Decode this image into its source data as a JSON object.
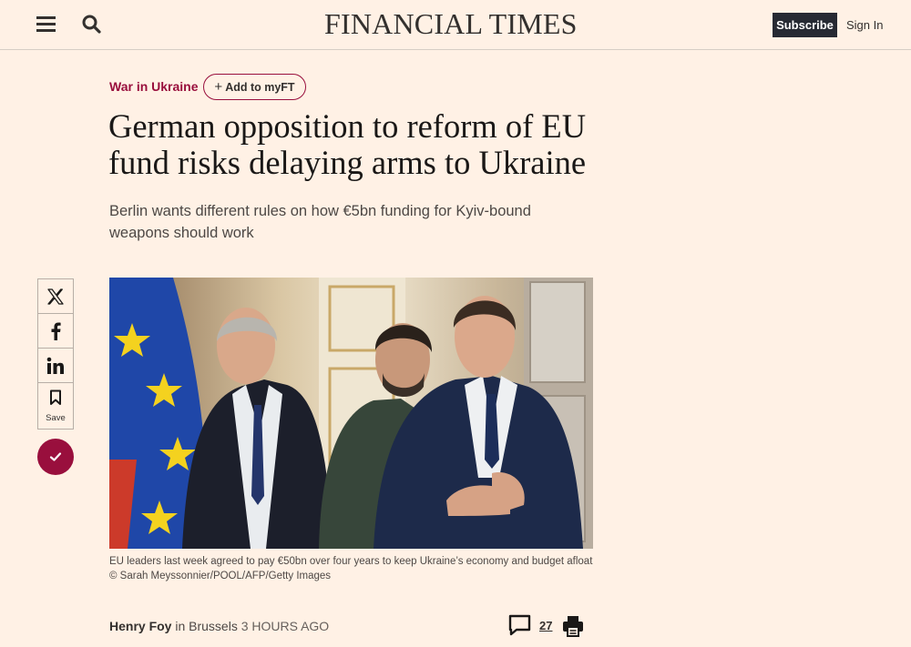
{
  "header": {
    "masthead": "FINANCIAL TIMES",
    "subscribe_label": "Subscribe",
    "signin_label": "Sign In"
  },
  "article": {
    "topic": "War in Ukraine",
    "add_myft_label": "Add to myFT",
    "headline": "German opposition to reform of EU fund risks delaying arms to Ukraine",
    "standfirst": "Berlin wants different rules on how €5bn funding for Kyiv-bound weapons should work",
    "caption": "EU leaders last week agreed to pay €50bn over four years to keep Ukraine’s economy and budget afloat © Sarah Meyssonnier/POOL/AFP/Getty Images",
    "author": "Henry Foy",
    "location_text": " in Brussels ",
    "timestamp": "3 HOURS AGO",
    "comment_count": "27"
  },
  "share": {
    "save_label": "Save",
    "icons": [
      "x-icon",
      "facebook-icon",
      "linkedin-icon",
      "bookmark-icon"
    ]
  },
  "colors": {
    "background": "#fff1e5",
    "accent": "#990f3d",
    "subscribe_bg": "#262a33"
  }
}
